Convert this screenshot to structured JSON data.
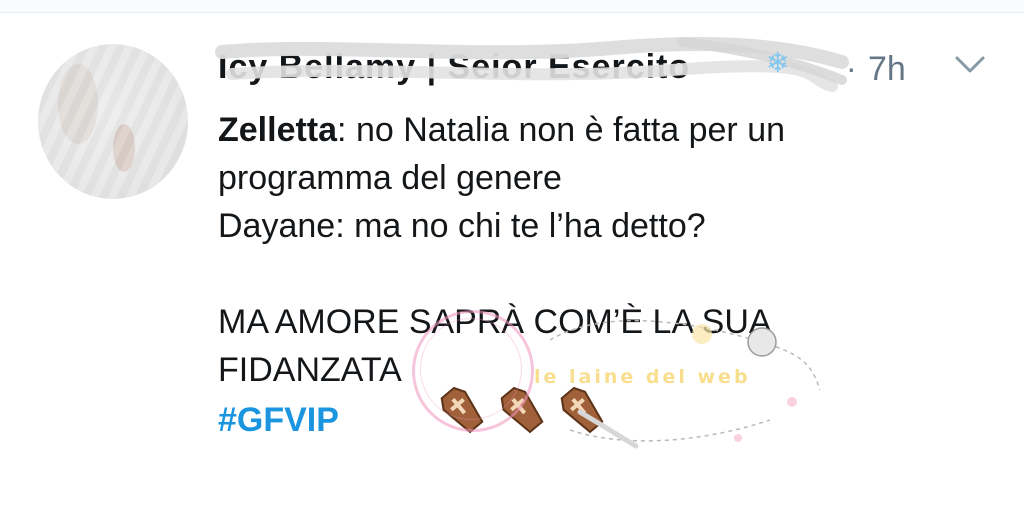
{
  "tweet": {
    "author_name": "Icy Bellamy | Seior Esercito",
    "author_badge_icon": "snowflake-icon",
    "separator": "·",
    "timestamp": "7h",
    "menu_icon": "chevron-down-icon",
    "lines": [
      {
        "speaker": "Zelletta",
        "text": ": no Natalia non è fatta per un"
      },
      {
        "speaker": "",
        "text": "programma del genere"
      },
      {
        "speaker": "",
        "text": "Dayane: ma no chi te l’ha detto?"
      }
    ],
    "shout_lines": [
      "MA AMORE SAPRÀ COM’È LA SUA",
      "FIDANZATA"
    ],
    "emoji_icons": [
      "coffin-icon",
      "coffin-icon",
      "coffin-icon"
    ],
    "hashtag": "#GFVIP"
  },
  "watermark": {
    "text": "le laine del web",
    "brand_color": "#f5cd50",
    "ring_color": "#f096be"
  },
  "colors": {
    "text": "#14171a",
    "muted": "#657786",
    "hashtag": "#1b95e0",
    "badge": "#7ec6f0"
  }
}
